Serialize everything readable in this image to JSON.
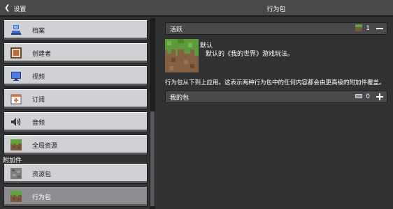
{
  "topbar": {
    "back_icon": "chevron-left-icon",
    "back_label": "设置",
    "title": "行为包"
  },
  "sidebar": {
    "section_label": "附加件",
    "items": [
      {
        "label": "档案",
        "icon": "profile-icon"
      },
      {
        "label": "创建者",
        "icon": "creator-icon"
      },
      {
        "label": "视频",
        "icon": "monitor-icon"
      },
      {
        "label": "订阅",
        "icon": "subscription-icon"
      },
      {
        "label": "音频",
        "icon": "speaker-icon"
      },
      {
        "label": "全局资源",
        "icon": "grass-block-icon"
      },
      {
        "label": "资源包",
        "icon": "stone-block-icon"
      },
      {
        "label": "行为包",
        "icon": "grass-block-icon",
        "active": true
      }
    ]
  },
  "main": {
    "active_header": "活跃",
    "active_count": "1",
    "active_pack": {
      "name": "默认",
      "description": "默认的《我的世界》游戏玩法。"
    },
    "info_text": "行为包从下到上应用。这表示两种行为包中的任何内容都会由更高级的附加件覆盖。",
    "my_packs_header": "我的包",
    "my_packs_count": "0"
  },
  "colors": {
    "background": "#313233",
    "header": "#48494a",
    "button": "#d0d1d4",
    "button_active": "#8c8d90"
  }
}
